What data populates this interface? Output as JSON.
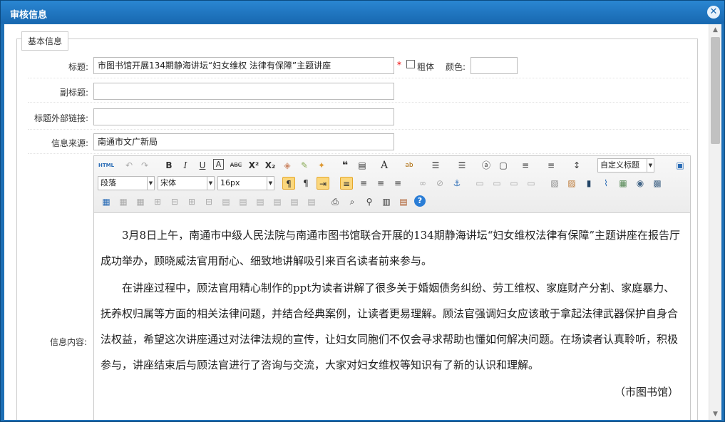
{
  "dialog": {
    "title": "审核信息",
    "close_glyph": "✕"
  },
  "group": {
    "legend": "基本信息"
  },
  "fields": {
    "title": {
      "label": "标题:",
      "value": "市图书馆开展134期静海讲坛“妇女维权 法律有保障”主题讲座",
      "required_mark": "*",
      "bold_label": "粗体",
      "color_label": "颜色:",
      "color_value": ""
    },
    "subtitle": {
      "label": "副标题:",
      "value": ""
    },
    "external_link": {
      "label": "标题外部链接:",
      "value": ""
    },
    "source": {
      "label": "信息来源:",
      "value": "南通市文广新局"
    },
    "content": {
      "label": "信息内容:"
    }
  },
  "toolbar": {
    "html_label": "HTML",
    "heading_select": "自定义标题",
    "paragraph_select": "段落",
    "font_select": "宋体",
    "size_select": "16px"
  },
  "article": {
    "p1": "3月8日上午，南通市中级人民法院与南通市图书馆联合开展的134期静海讲坛“妇女维权法律有保障”主题讲座在报告厅成功举办，顾晓威法官用耐心、细致地讲解吸引来百名读者前来参与。",
    "p2": "在讲座过程中，顾法官用精心制作的ppt为读者讲解了很多关于婚姻债务纠纷、劳工维权、家庭财产分割、家庭暴力、抚养权归属等方面的相关法律问题，并结合经典案例，让读者更易理解。顾法官强调妇女应该敢于拿起法律武器保护自身合法权益，希望这次讲座通过对法律法规的宣传，让妇女同胞们不仅会寻求帮助也懂如何解决问题。在场读者认真聆听，积极参与，讲座结束后与顾法官进行了咨询与交流，大家对妇女维权等知识有了新的认识和理解。",
    "p3": "（市图书馆）"
  },
  "scrollbar": {
    "up": "▲",
    "down": "▼"
  }
}
